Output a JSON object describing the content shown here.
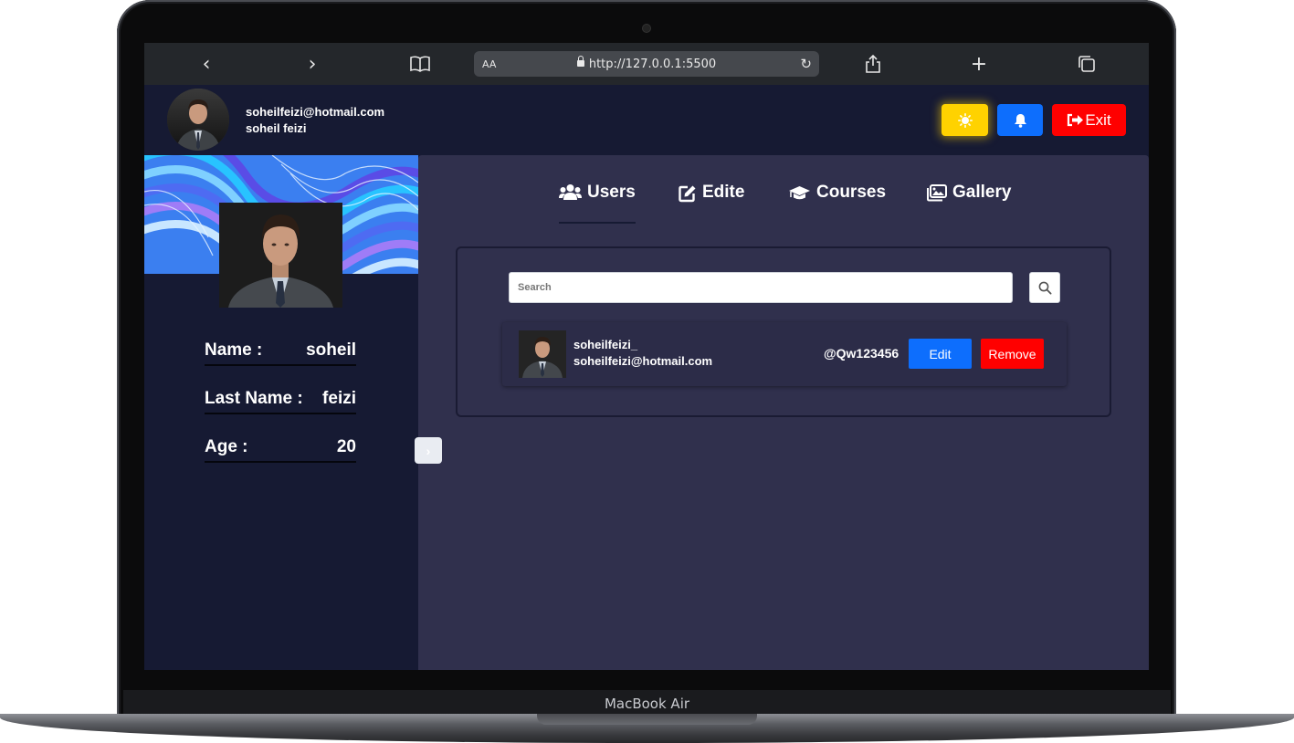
{
  "device": {
    "label": "MacBook Air"
  },
  "browser": {
    "text_size_label": "AA",
    "url": "http://127.0.0.1:5500"
  },
  "header": {
    "email": "soheilfeizi@hotmail.com",
    "full_name": "soheil feizi",
    "exit_label": "Exit"
  },
  "profile": {
    "fields": [
      {
        "label": "Name :",
        "value": "soheil"
      },
      {
        "label": "Last Name :",
        "value": "feizi"
      },
      {
        "label": "Age :",
        "value": "20"
      }
    ]
  },
  "tabs": [
    {
      "label": "Users",
      "icon": "users-icon",
      "active": true
    },
    {
      "label": "Edite",
      "icon": "edit-icon",
      "active": false
    },
    {
      "label": "Courses",
      "icon": "graduation-cap-icon",
      "active": false
    },
    {
      "label": "Gallery",
      "icon": "images-icon",
      "active": false
    }
  ],
  "users_panel": {
    "search_placeholder": "Search",
    "rows": [
      {
        "username": "soheilfeizi_",
        "email": "soheilfeizi@hotmail.com",
        "password": "@Qw123456",
        "edit_label": "Edit",
        "remove_label": "Remove"
      }
    ]
  },
  "colors": {
    "accent_blue": "#0d6efd",
    "danger_red": "#ff0000",
    "theme_yellow": "#ffd200",
    "sidebar_bg": "#161a33",
    "main_bg": "#30304d"
  }
}
